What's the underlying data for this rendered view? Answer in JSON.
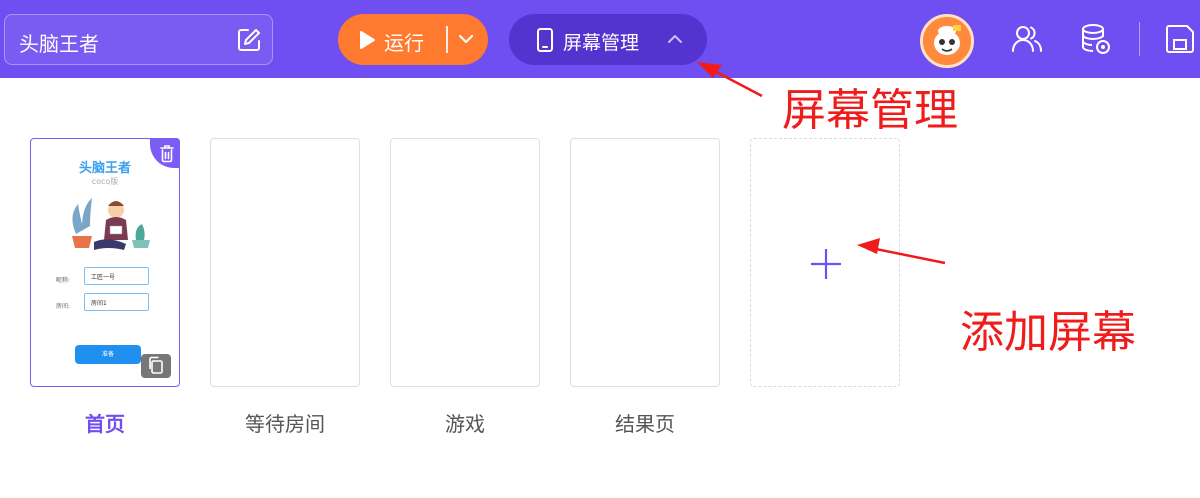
{
  "topbar": {
    "project_name": "头脑王者",
    "run_label": "运行",
    "screen_manage_label": "屏幕管理",
    "accent_color": "#6f4ff2",
    "run_color": "#ff7a2e",
    "icons": [
      "edit-icon",
      "play-icon",
      "chevron-down-icon",
      "phone-icon",
      "chevron-up-icon",
      "avatar",
      "users-icon",
      "database-settings-icon",
      "save-icon"
    ]
  },
  "screens": [
    {
      "label": "首页",
      "active": true
    },
    {
      "label": "等待房间",
      "active": false
    },
    {
      "label": "游戏",
      "active": false
    },
    {
      "label": "结果页",
      "active": false
    }
  ],
  "thumbnail": {
    "title": "头脑王者",
    "subtitle": "coco版",
    "nickname_label": "昵称:",
    "nickname_value": "工匠一号",
    "room_label": "房间:",
    "room_value": "房间1",
    "ready_button": "准备"
  },
  "add_screen": {
    "icon": "plus-icon"
  },
  "annotations": {
    "screen_manage": "屏幕管理",
    "add_screen": "添加屏幕",
    "color": "#f01c1c"
  }
}
